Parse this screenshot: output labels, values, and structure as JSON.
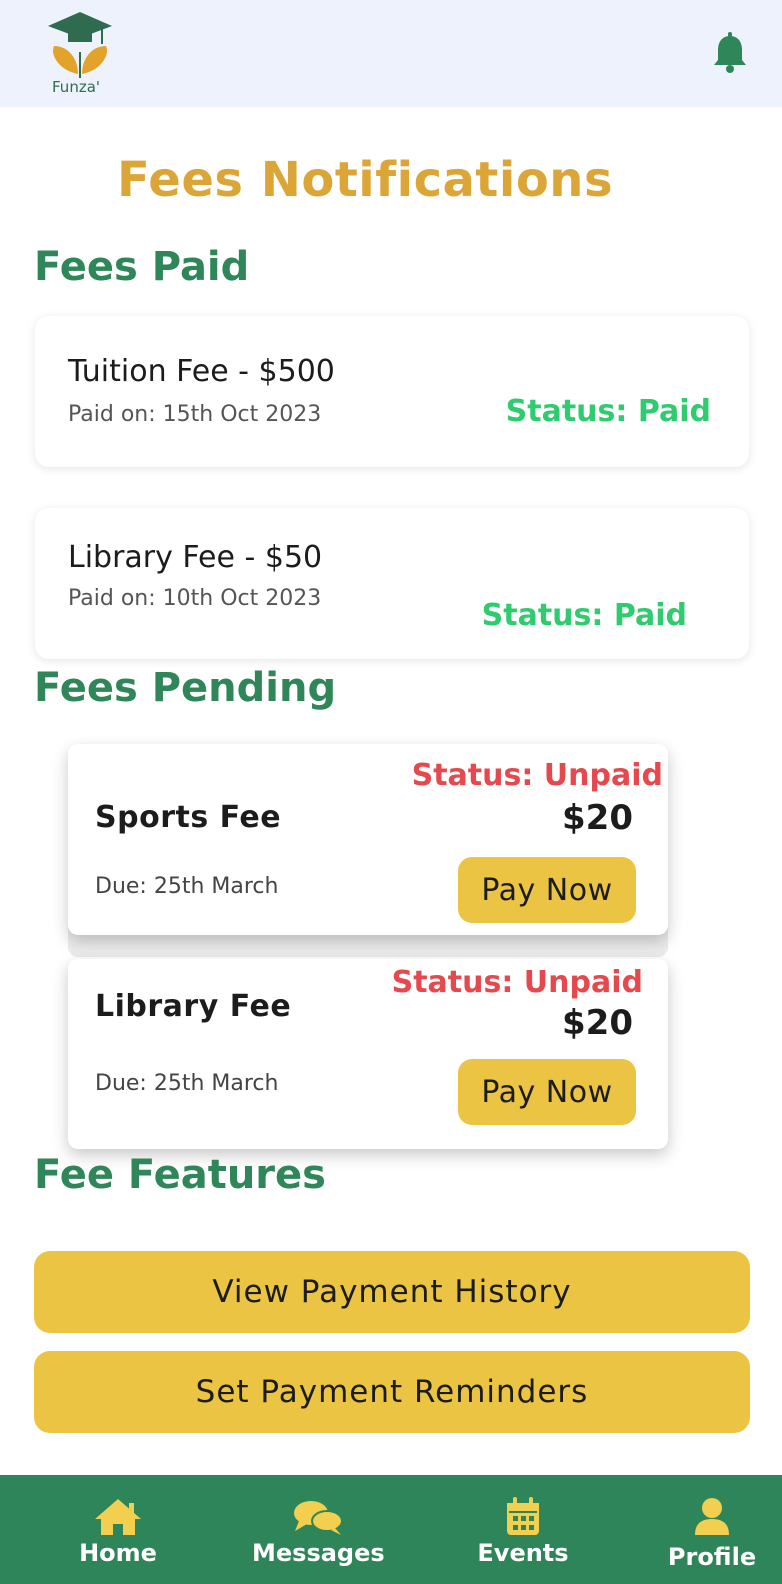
{
  "app": {
    "logo_text": "Funza'"
  },
  "page_title": "Fees Notifications",
  "fees_paid": {
    "heading": "Fees Paid",
    "items": [
      {
        "title": "Tuition Fee - $500",
        "date": "Paid on: 15th Oct 2023",
        "status": "Status: Paid"
      },
      {
        "title": "Library Fee - $50",
        "date": "Paid on: 10th Oct 2023",
        "status": "Status: Paid"
      }
    ]
  },
  "fees_pending": {
    "heading": "Fees Pending",
    "items": [
      {
        "title": "Sports Fee",
        "due": "Due: 25th March",
        "status": "Status: Unpaid",
        "amount": "$20",
        "button": "Pay Now"
      },
      {
        "title": "Library Fee",
        "due": "Due: 25th March",
        "status": "Status: Unpaid",
        "amount": "$20",
        "button": "Pay Now"
      }
    ]
  },
  "fee_features": {
    "heading": "Fee Features",
    "buttons": [
      "View Payment History",
      "Set Payment Reminders"
    ]
  },
  "nav": {
    "items": [
      {
        "label": "Home",
        "icon": "home-icon"
      },
      {
        "label": "Messages",
        "icon": "messages-icon"
      },
      {
        "label": "Events",
        "icon": "calendar-icon"
      },
      {
        "label": "Profile",
        "icon": "user-icon"
      }
    ]
  },
  "colors": {
    "header_bg": "#eef2fc",
    "title_gold": "#dca537",
    "section_green": "#2e8659",
    "paid_green": "#2ecc6e",
    "unpaid_red": "#e5484d",
    "button_yellow": "#ecc444",
    "nav_green": "#2d8559"
  }
}
